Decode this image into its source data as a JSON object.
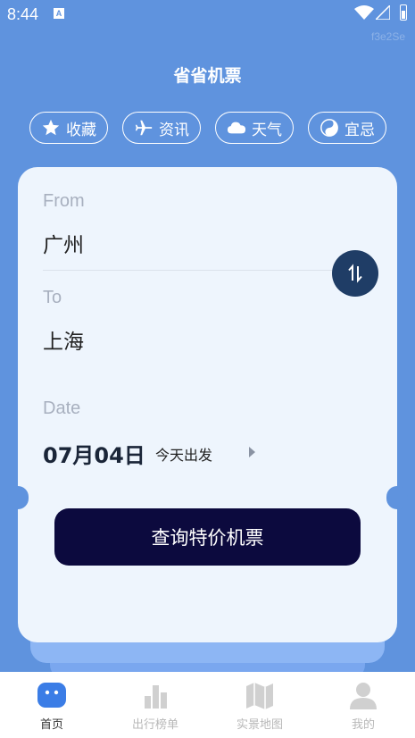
{
  "status_bar": {
    "time": "8:44",
    "notification_icon": "A",
    "watermark": "f3e2Se"
  },
  "header": {
    "title": "省省机票"
  },
  "quick_actions": [
    {
      "label": "收藏",
      "icon": "star-icon"
    },
    {
      "label": "资讯",
      "icon": "airplane-icon"
    },
    {
      "label": "天气",
      "icon": "cloud-icon"
    },
    {
      "label": "宜忌",
      "icon": "yin-yang-icon"
    }
  ],
  "search_card": {
    "from_label": "From",
    "from_city": "广州",
    "to_label": "To",
    "to_city": "上海",
    "date_label": "Date",
    "date_value": "07月04日",
    "date_note": "今天出发",
    "search_button": "查询特价机票"
  },
  "tab_bar": {
    "active": "首页",
    "items": [
      {
        "label": "首页",
        "icon": "home-icon"
      },
      {
        "label": "出行榜单",
        "icon": "bar-chart-icon"
      },
      {
        "label": "实景地图",
        "icon": "map-icon"
      },
      {
        "label": "我的",
        "icon": "user-icon"
      }
    ]
  },
  "colors": {
    "background": "#5f93de",
    "card": "#eef5fd",
    "primary_button": "#0c0a3e",
    "swap_button": "#1f3d66",
    "tab_active": "#3b7de6"
  }
}
